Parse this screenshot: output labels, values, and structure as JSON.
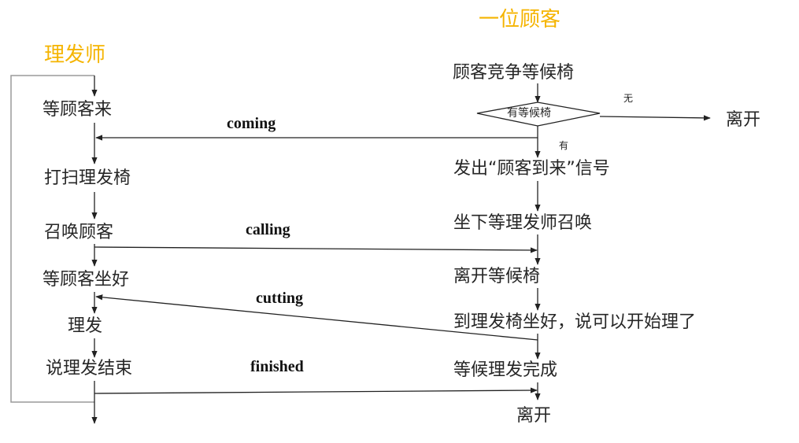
{
  "barber": {
    "title": "理发师",
    "steps": [
      "等顾客来",
      "打扫理发椅",
      "召唤顾客",
      "等顾客坐好",
      "理发",
      "说理发结束"
    ]
  },
  "customer": {
    "title": "一位顾客",
    "steps": [
      "顾客竞争等候椅",
      "发出“顾客到来”信号",
      "坐下等理发师召唤",
      "离开等候椅",
      "到理发椅坐好，说可以开始理了",
      "等候理发完成",
      "离开"
    ],
    "decision": "有等候椅",
    "branch_no": "无",
    "branch_yes": "有",
    "leave": "离开"
  },
  "signals": {
    "coming": "coming",
    "calling": "calling",
    "cutting": "cutting",
    "finished": "finished"
  },
  "colors": {
    "title": "#f5b400",
    "line": "#222222",
    "loop": "#999999"
  }
}
